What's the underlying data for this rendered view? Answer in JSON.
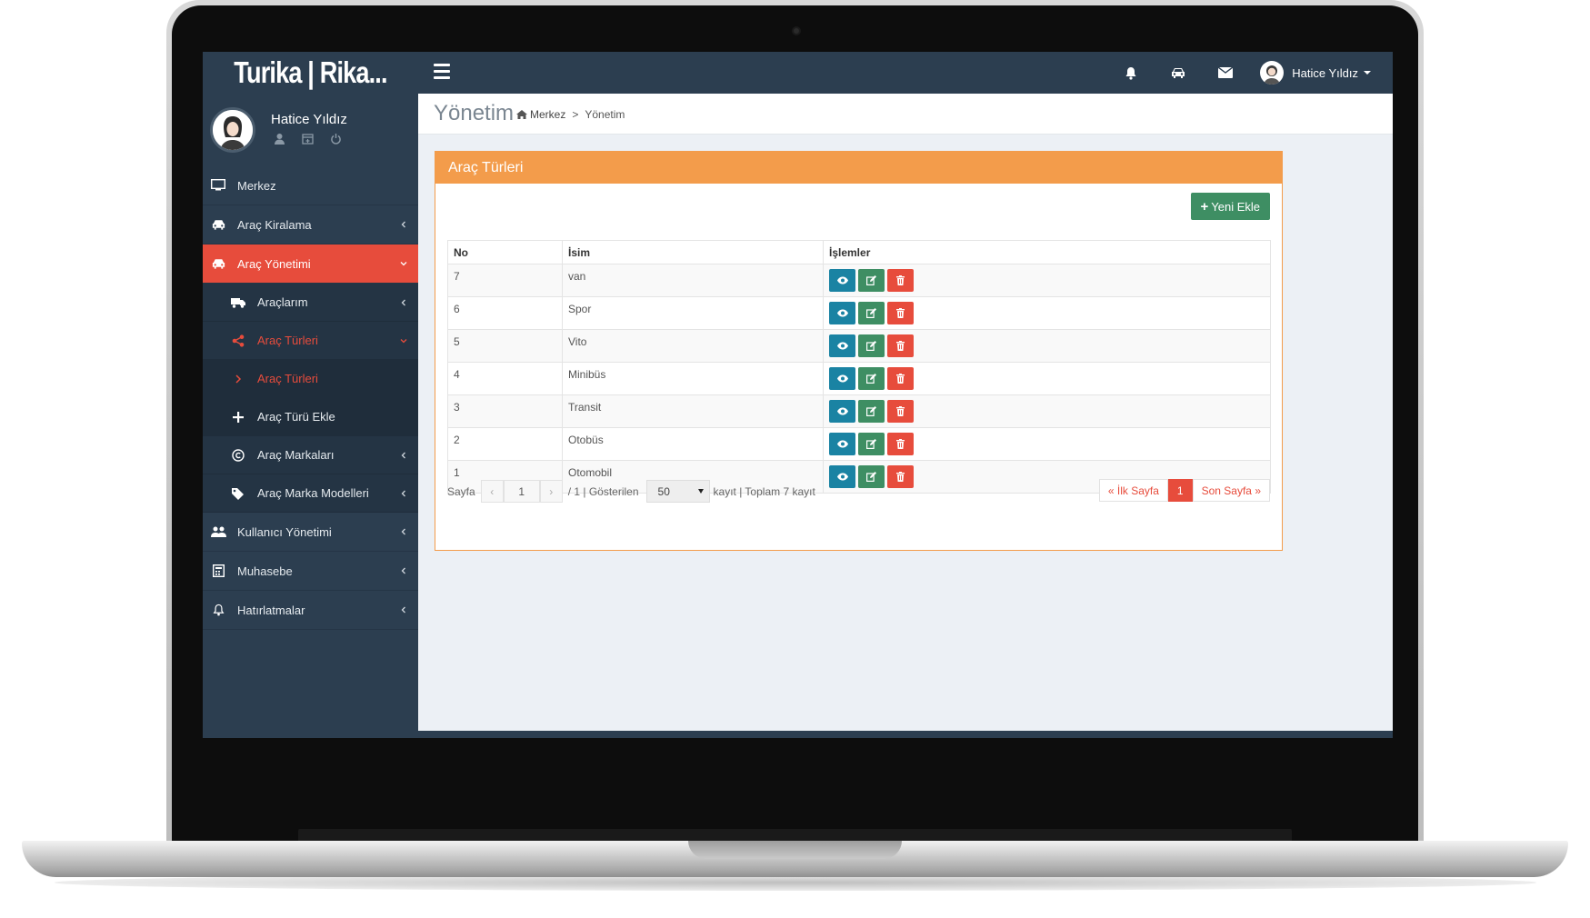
{
  "app": {
    "logo": "Turika | Rika..."
  },
  "topbar": {
    "icons": [
      "bell-icon",
      "car-icon",
      "envelope-icon"
    ],
    "user_name": "Hatice Yıldız"
  },
  "sidebar": {
    "user_name": "Hatice Yıldız",
    "user_icons": [
      "user-icon",
      "calendar-icon",
      "power-icon"
    ],
    "items": [
      {
        "label": "Merkez",
        "icon": "desktop-icon"
      },
      {
        "label": "Araç Kiralama",
        "icon": "taxi-icon"
      },
      {
        "label": "Araç Yönetimi",
        "icon": "car-icon"
      },
      {
        "label": "Araçlarım",
        "icon": "truck-icon"
      },
      {
        "label": "Araç Türleri",
        "icon": "share-icon"
      },
      {
        "label": "Araç Türleri",
        "icon": "chevron-right-icon"
      },
      {
        "label": "Araç Türü Ekle",
        "icon": "plus-icon"
      },
      {
        "label": "Araç Markaları",
        "icon": "copyright-icon"
      },
      {
        "label": "Araç Marka Modelleri",
        "icon": "tags-icon"
      },
      {
        "label": "Kullanıcı Yönetimi",
        "icon": "users-icon"
      },
      {
        "label": "Muhasebe",
        "icon": "calculator-icon"
      },
      {
        "label": "Hatırlatmalar",
        "icon": "bell-icon"
      }
    ]
  },
  "header": {
    "title": "Yönetim",
    "breadcrumb": [
      "Merkez",
      "Yönetim"
    ],
    "breadcrumb_sep": ">"
  },
  "box": {
    "title": "Araç Türleri",
    "new_button": "Yeni Ekle",
    "new_button_icon": "+"
  },
  "table": {
    "columns": [
      "No",
      "İsim",
      "İşlemler"
    ],
    "rows": [
      {
        "no": "7",
        "name": "van"
      },
      {
        "no": "6",
        "name": "Spor"
      },
      {
        "no": "5",
        "name": "Vito"
      },
      {
        "no": "4",
        "name": "Minibüs"
      },
      {
        "no": "3",
        "name": "Transit"
      },
      {
        "no": "2",
        "name": "Otobüs"
      },
      {
        "no": "1",
        "name": "Otomobil"
      }
    ],
    "actions": [
      "eye-icon",
      "edit-icon",
      "trash-icon"
    ]
  },
  "pager": {
    "page_label": "Sayfa",
    "prev": "‹",
    "next": "›",
    "current_page": "1",
    "of_text": "/ 1 | Gösterilen",
    "page_size": "50",
    "suffix_text": "kayıt | Toplam 7 kayıt",
    "first": "« İlk Sayfa",
    "active": "1",
    "last": "Son Sayfa »"
  },
  "colors": {
    "navbar": "#2c3e50",
    "accent_red": "#e74c3c",
    "box_orange": "#f39c4b",
    "btn_green": "#3e8e63",
    "btn_blue": "#1a83a3"
  }
}
